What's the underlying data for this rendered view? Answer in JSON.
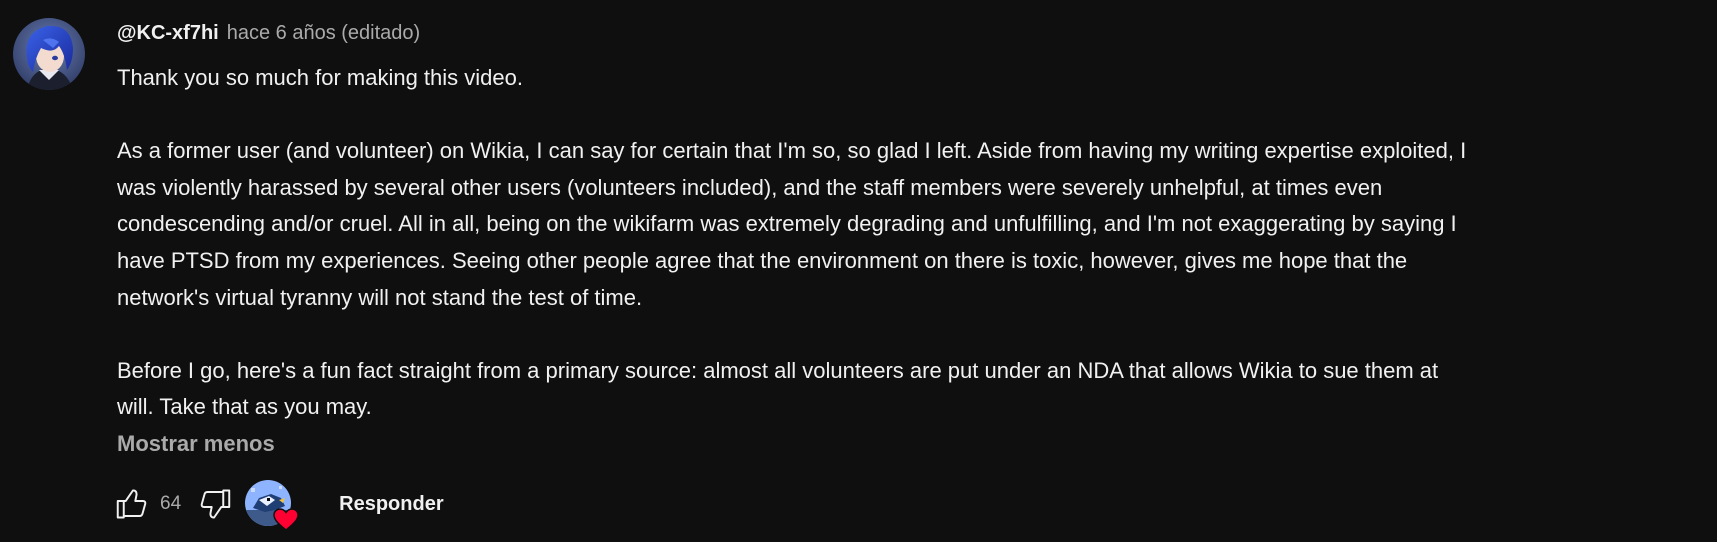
{
  "comment": {
    "author": "@KC-xf7hi",
    "timestamp": "hace 6 años (editado)",
    "paragraphs": [
      {
        "lines": [
          "Thank you so much for making this video."
        ]
      },
      {
        "lines": [
          "As a former user (and volunteer) on Wikia, I can say for certain that I'm so, so glad I left. Aside from having my writing expertise exploited, I",
          "was violently harassed by several other users (volunteers included), and the staff members were severely unhelpful, at times even",
          "condescending and/or cruel. All in all, being on the wikifarm was extremely degrading and unfulfilling, and I'm not exaggerating by saying I",
          "have PTSD from my experiences. Seeing other people agree that the environment on there is toxic, however, gives me hope that the",
          "network's virtual tyranny will not stand the test of time."
        ]
      },
      {
        "lines": [
          "Before I go, here's a fun fact straight from a primary source: almost all volunteers are put under an NDA that allows Wikia to sue them at",
          "will. Take that as you may."
        ]
      }
    ],
    "show_less_label": "Mostrar menos",
    "like_count": "64",
    "reply_label": "Responder",
    "icons": {
      "avatar": "user-avatar",
      "like": "thumbs-up-icon",
      "dislike": "thumbs-down-icon",
      "creator_heart": "creator-heart-icon"
    },
    "colors": {
      "background": "#0f0f0f",
      "text": "#f1f1f1",
      "secondary_text": "#aaaaaa",
      "heart": "#ff0033"
    }
  }
}
